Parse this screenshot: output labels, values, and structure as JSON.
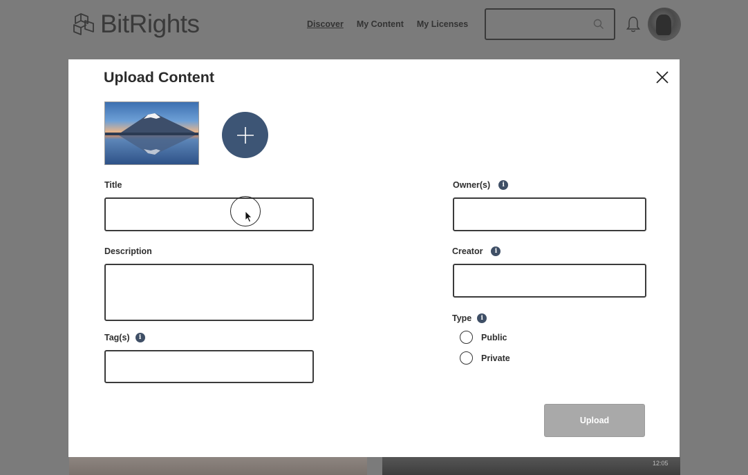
{
  "app": {
    "name": "BitRights",
    "nav": [
      {
        "label": "Discover",
        "active": true
      },
      {
        "label": "My Content",
        "active": false
      },
      {
        "label": "My Licenses",
        "active": false
      }
    ],
    "search": {
      "value": "",
      "placeholder": ""
    }
  },
  "modal": {
    "title": "Upload Content",
    "fields": {
      "title": {
        "label": "Title",
        "value": ""
      },
      "description": {
        "label": "Description",
        "value": ""
      },
      "tags": {
        "label": "Tag(s)",
        "value": ""
      },
      "owners": {
        "label": "Owner(s)",
        "value": ""
      },
      "creator": {
        "label": "Creator",
        "value": ""
      }
    },
    "type": {
      "label": "Type",
      "options": [
        "Public",
        "Private"
      ],
      "selected": null
    },
    "info_glyph": "i",
    "upload_label": "Upload"
  },
  "background": {
    "video_time": "12:05"
  },
  "colors": {
    "accent": "#3d5575",
    "upload_disabled": "#a9a9a9",
    "overlay": "#7b7b7b"
  }
}
